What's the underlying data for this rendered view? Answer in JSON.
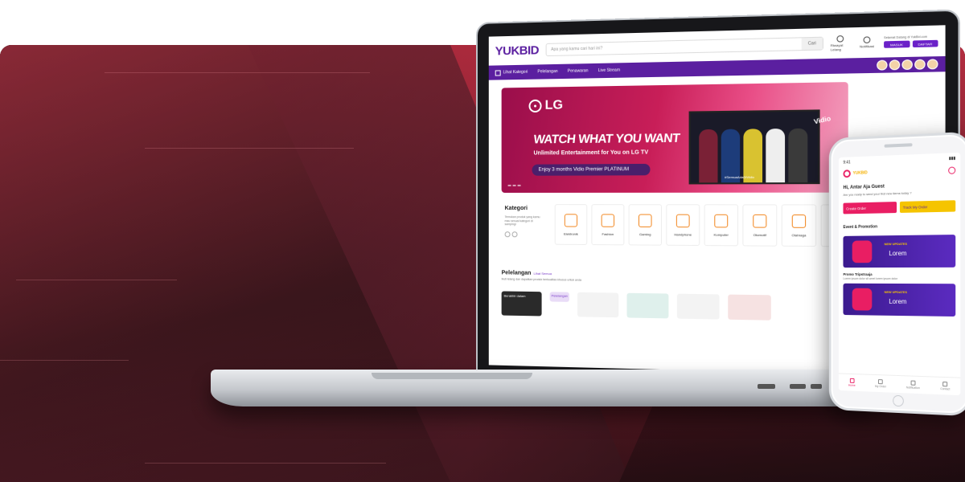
{
  "site": {
    "logo": "YUKBID",
    "search_placeholder": "Apa yang kamu cari hari ini?",
    "search_button": "Cari",
    "top_icons": [
      "Riwayat Lelang",
      "Notifikasi"
    ],
    "auth_hint": "Selamat Datang di YukBid.com",
    "login_label": "MASUK",
    "register_label": "DAFTAR",
    "nav": {
      "categories_label": "Lihat Kategori",
      "items": [
        "Pelelangan",
        "Penawaran",
        "Live Stream"
      ]
    },
    "hero": {
      "brand": "LG",
      "headline": "WATCH WHAT YOU WANT",
      "subline": "Unlimited Entertainment for You on LG TV",
      "offer": "Enjoy 3 months Vidio Premier PLATINUM",
      "partner": "Vidio",
      "hashtag": "#SemuaAdaDiVidio"
    },
    "kategori": {
      "title": "Kategori",
      "subtitle": "Temukan produk yang kamu mau sesuai kategori di sampingi",
      "items": [
        "Elektronik",
        "Fashion",
        "Gaming",
        "Handphone",
        "Komputer",
        "Otomotif",
        "Olahraga",
        "Mainan"
      ]
    },
    "pelelangan": {
      "title": "Pelelangan",
      "see_all": "Lihat Semua",
      "subtitle": "Ikuti lelang dan dapatkan produk berkualitas khusus untuk anda",
      "tag1": "Berakhir dalam",
      "tag2": "Pelelangan"
    }
  },
  "mobile": {
    "time": "9:41",
    "logo": "YUKBID",
    "greeting": "Hi, Antar Aja Guest",
    "question": "Are you ready to send your first new items today ?",
    "create_order": "Create Order",
    "track_order": "Track My Order",
    "events_title": "Event & Promotion",
    "card_badge": "NEW UPDATES",
    "card_text": "Lorem",
    "promo_title": "Promo Tripstraaja",
    "promo_sub": "Lorem ipsum dolor sit amet lorem ipsum dolor",
    "tabs": [
      "Home",
      "My Order",
      "Notification",
      "Contact"
    ]
  }
}
